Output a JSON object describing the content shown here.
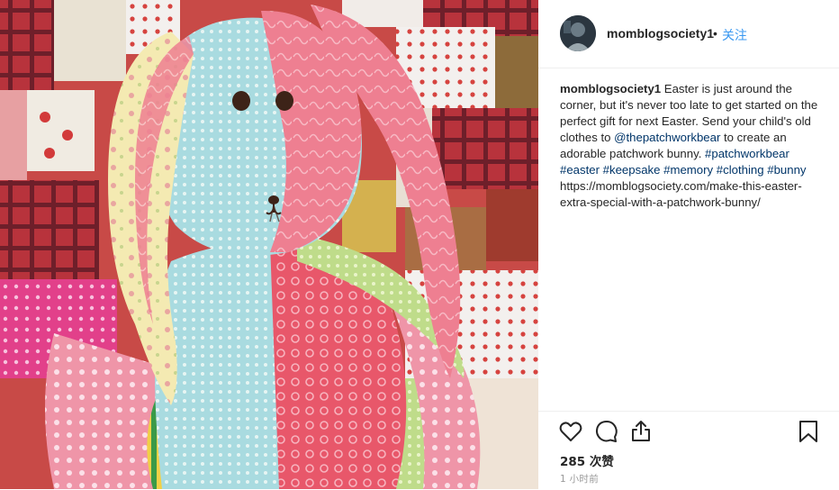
{
  "post": {
    "username": "momblogsociety1",
    "separator": "•",
    "follow_label": "关注"
  },
  "caption": {
    "username": "momblogsociety1",
    "text_1": " Easter is just around the corner, but it's never too late to get started on the perfect gift for next Easter. Send your child's old clothes to ",
    "mention": "@thepatchworkbear",
    "text_2": " to create an adorable patchwork bunny. ",
    "hashtags": [
      "#patchworkbear",
      "#easter",
      "#keepsake",
      "#memory",
      "#clothing",
      "#bunny"
    ],
    "url": "https://momblogsociety.com/make-this-easter-extra-special-with-a-patchwork-bunny/"
  },
  "actions": {
    "icons": [
      "heart-icon",
      "comment-icon",
      "share-icon",
      "bookmark-icon"
    ]
  },
  "likes_text": "285 次赞",
  "timestamp": "1 小时前",
  "colors": {
    "link": "#003569",
    "follow": "#3897f0",
    "divider": "#efefef",
    "muted": "#999999"
  }
}
